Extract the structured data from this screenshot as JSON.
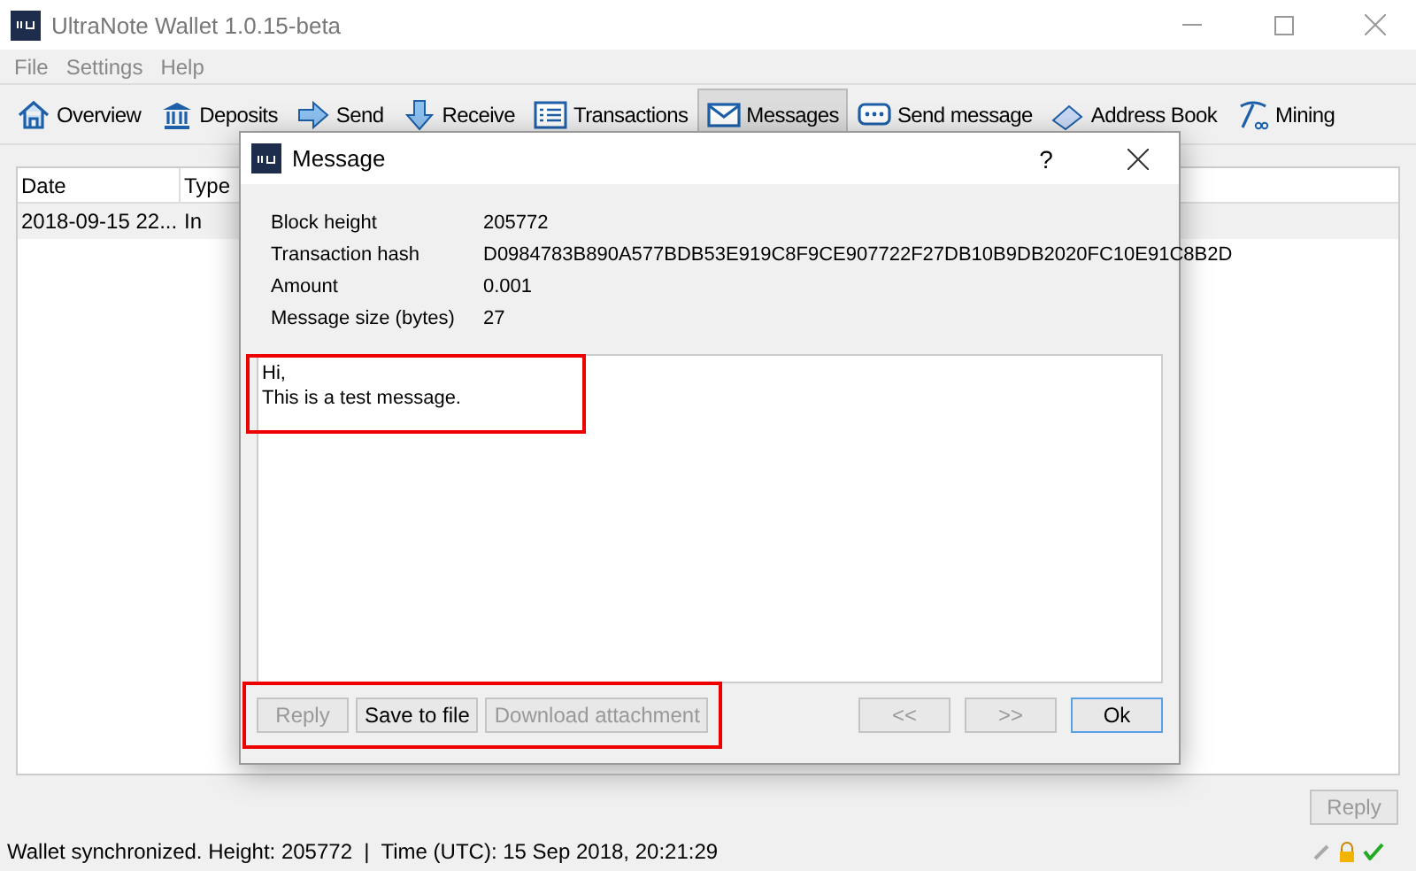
{
  "window": {
    "title": "UltraNote Wallet 1.0.15-beta"
  },
  "menu": [
    "File",
    "Settings",
    "Help"
  ],
  "toolbar": [
    {
      "label": "Overview",
      "selected": false
    },
    {
      "label": "Deposits",
      "selected": false
    },
    {
      "label": "Send",
      "selected": false
    },
    {
      "label": "Receive",
      "selected": false
    },
    {
      "label": "Transactions",
      "selected": false
    },
    {
      "label": "Messages",
      "selected": true
    },
    {
      "label": "Send message",
      "selected": false
    },
    {
      "label": "Address Book",
      "selected": false
    },
    {
      "label": "Mining",
      "selected": false
    }
  ],
  "table": {
    "columns": [
      "Date",
      "Type"
    ],
    "rows": [
      [
        "2018-09-15 22...",
        "In"
      ]
    ]
  },
  "reply_button": {
    "label": "Reply",
    "disabled": true
  },
  "status_bar": "Wallet synchronized. Height: 205772  |  Time (UTC): 15 Sep 2018, 20:21:29",
  "dialog": {
    "title": "Message",
    "help": "?",
    "fields": [
      {
        "label": "Block height",
        "value": "205772"
      },
      {
        "label": "Transaction hash",
        "value": "D0984783B890A577BDB53E919C8F9CE907722F27DB10B9DB2020FC10E91C8B2D"
      },
      {
        "label": "Amount",
        "value": "0.001"
      },
      {
        "label": "Message size (bytes)",
        "value": "27"
      }
    ],
    "message": [
      "Hi,",
      "This is a test message."
    ],
    "message_highlighted": true,
    "buttons_highlighted": true,
    "left_buttons": [
      {
        "label": "Reply",
        "disabled": true
      },
      {
        "label": "Save to file",
        "disabled": false
      },
      {
        "label": "Download attachment",
        "disabled": true
      }
    ],
    "right_buttons": [
      {
        "label": "<<",
        "disabled": true,
        "default": false
      },
      {
        "label": ">>",
        "disabled": true,
        "default": false
      },
      {
        "label": "Ok",
        "disabled": false,
        "default": true
      }
    ]
  }
}
